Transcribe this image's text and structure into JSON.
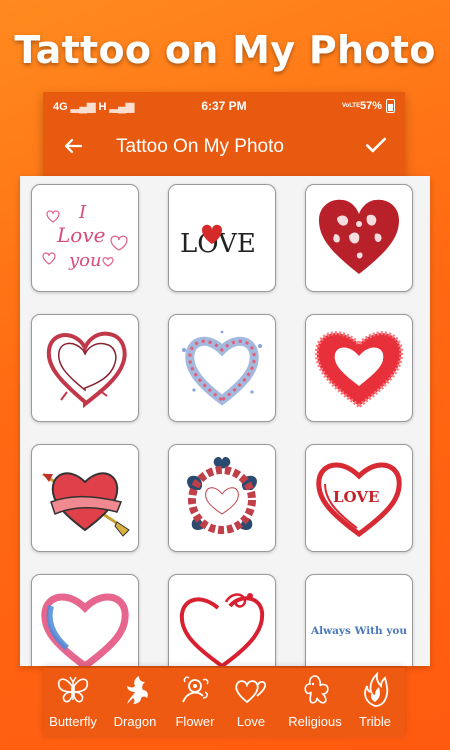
{
  "banner": {
    "title": "Tattoo on My Photo"
  },
  "status_bar": {
    "network": "4G",
    "network2": "H",
    "time": "6:37 PM",
    "volte": "VoLTE",
    "battery": "57%"
  },
  "toolbar": {
    "title": "Tattoo On My Photo",
    "back_icon": "arrow-back-icon",
    "confirm_icon": "check-icon"
  },
  "tattoos": [
    {
      "name": "i-love-you-script",
      "text": [
        "I",
        "Love",
        "you"
      ]
    },
    {
      "name": "love-word-heart",
      "text": "LOVE"
    },
    {
      "name": "ornamental-red-heart"
    },
    {
      "name": "sketch-heart"
    },
    {
      "name": "splatter-heart"
    },
    {
      "name": "spiky-red-heart"
    },
    {
      "name": "arrow-ribbon-heart"
    },
    {
      "name": "floral-wreath-heart"
    },
    {
      "name": "brush-heart-love",
      "text": "LOVE"
    },
    {
      "name": "watercolor-heart"
    },
    {
      "name": "swirl-heart"
    },
    {
      "name": "always-with-you-text",
      "text": "Always With you"
    }
  ],
  "categories": [
    {
      "label": "Butterfly",
      "icon": "butterfly-icon"
    },
    {
      "label": "Dragon",
      "icon": "dragon-icon"
    },
    {
      "label": "Flower",
      "icon": "flower-icon"
    },
    {
      "label": "Love",
      "icon": "hearts-icon"
    },
    {
      "label": "Religious",
      "icon": "ganesha-icon"
    },
    {
      "label": "Trible",
      "icon": "flame-icon"
    }
  ],
  "colors": {
    "accent": "#e85a10",
    "background_gradient": [
      "#ff8a1e",
      "#ff5a10"
    ],
    "tile_border": "#9a9a9a"
  }
}
